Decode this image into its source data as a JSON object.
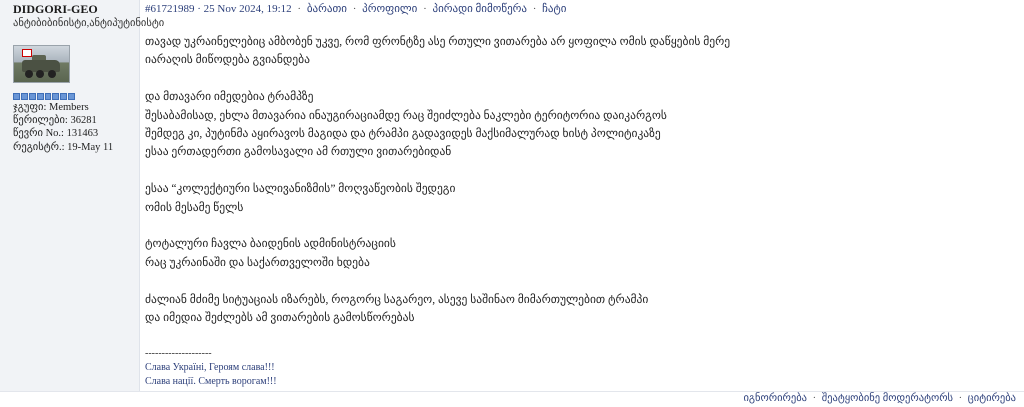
{
  "author": {
    "name": "DIDGORI-GEO",
    "title": "ანტიბიბინისტი,ანტიპუტინისტი",
    "group_label": "ჯგუფი:",
    "group": "Members",
    "posts_label": "წერილები:",
    "posts": "36281",
    "member_no_label": "წევრი No.:",
    "member_no": "131463",
    "registered_label": "რეგისტრ.:",
    "registered": "19-May 11",
    "rank_pips": 8
  },
  "post": {
    "id": "#61721989",
    "date": "25 Nov 2024, 19:12",
    "actions": [
      "ბარათი",
      "პროფილი",
      "პირადი მიმოწერა",
      "ჩატი"
    ],
    "paragraphs": [
      [
        "თავად უკრაინელებიც ამბობენ უკვე, რომ ფრონტზე ასე რთული ვითარება არ ყოფილა ომის დაწყების მერე",
        "იარაღის მიწოდება გვიანდება"
      ],
      [
        "და მთავარი იმედებია ტრამპზე",
        "შესაბამისად, ეხლა მთავარია ინაუგირაციამდე რაც შეიძლება ნაკლები ტერიტორია დაიკარგოს",
        "შემდეგ კი, პუტინმა აყირავოს მაგიდა და ტრამპი გადავიდეს მაქსიმალურად ხისტ პოლიტიკაზე",
        "ესაა ერთადერთი გამოსავალი ამ რთული ვითარებიდან"
      ],
      [
        "ესაა “კოლექტიური სალივანიზმის” მოღვაწეობის შედეგი",
        "ომის მესამე წელს"
      ],
      [
        "ტოტალური ჩავლა ბაიდენის ადმინისტრაციის",
        "რაც უკრაინაში და საქართველოში ხდება"
      ],
      [
        "ძალიან მძიმე სიტუაციას იზარებს, როგორც საგარეო, ასევე საშინაო მიმართულებით ტრამპი",
        "და იმედია შეძლებს ამ ვითარების გამოსწორებას"
      ]
    ],
    "signature": {
      "separator": "--------------------",
      "lines": [
        "Слава Україні, Героям слава!!!",
        "Слава нації. Смерть ворогам!!!"
      ]
    }
  },
  "footer": {
    "actions": [
      "იგნორირება",
      "შეატყობინე მოდერატორს",
      "ციტირება"
    ]
  }
}
